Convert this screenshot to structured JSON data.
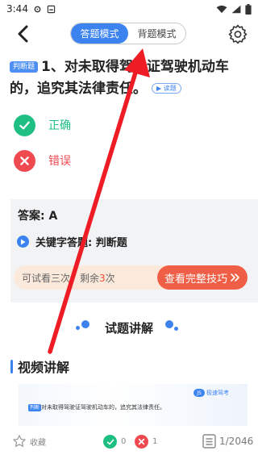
{
  "status_bar": {
    "time": "3:44",
    "icons": [
      "settings-gear-icon",
      "notification-box-icon",
      "wifi-icon",
      "signal-icon",
      "battery-icon"
    ]
  },
  "header": {
    "back_icon": "chevron-left-icon",
    "mode_tabs": [
      {
        "label": "答题模式",
        "active": true
      },
      {
        "label": "背题模式",
        "active": false
      }
    ],
    "settings_icon": "gear-icon"
  },
  "question": {
    "type_badge": "判断题",
    "text": "1、对未取得驾驶证驾驶机动车的，追究其法律责任。",
    "read_button": "▶ 读题"
  },
  "options": [
    {
      "label": "正确",
      "icon": "check-circle-icon",
      "color": "#1fbf83"
    },
    {
      "label": "错误",
      "icon": "x-circle-icon",
      "color": "#ef4a50"
    }
  ],
  "answer": {
    "answer_text": "答案: A",
    "keyword_text": "关键字答题: 判断题",
    "trial_prefix": "可试看三次，剩余",
    "trial_remaining": "3",
    "trial_suffix": "次",
    "tips_button": "查看完整技巧"
  },
  "section_title": "试题讲解",
  "video_section": {
    "title": "视频讲解",
    "thumb_badge": "判断",
    "thumb_caption": "对未取得驾驶证驾驶机动车的，追究其法律责任。",
    "thumb_logo": "极速驾考"
  },
  "bottom_bar": {
    "favorite_label": "收藏",
    "correct_count": "0",
    "wrong_count": "1",
    "progress": "1/2046"
  },
  "colors": {
    "accent": "#3d83f0",
    "correct": "#1fbf83",
    "wrong": "#ef4a50",
    "tips_button": "#ee5f45",
    "annotation_arrow": "#ee1c25"
  }
}
